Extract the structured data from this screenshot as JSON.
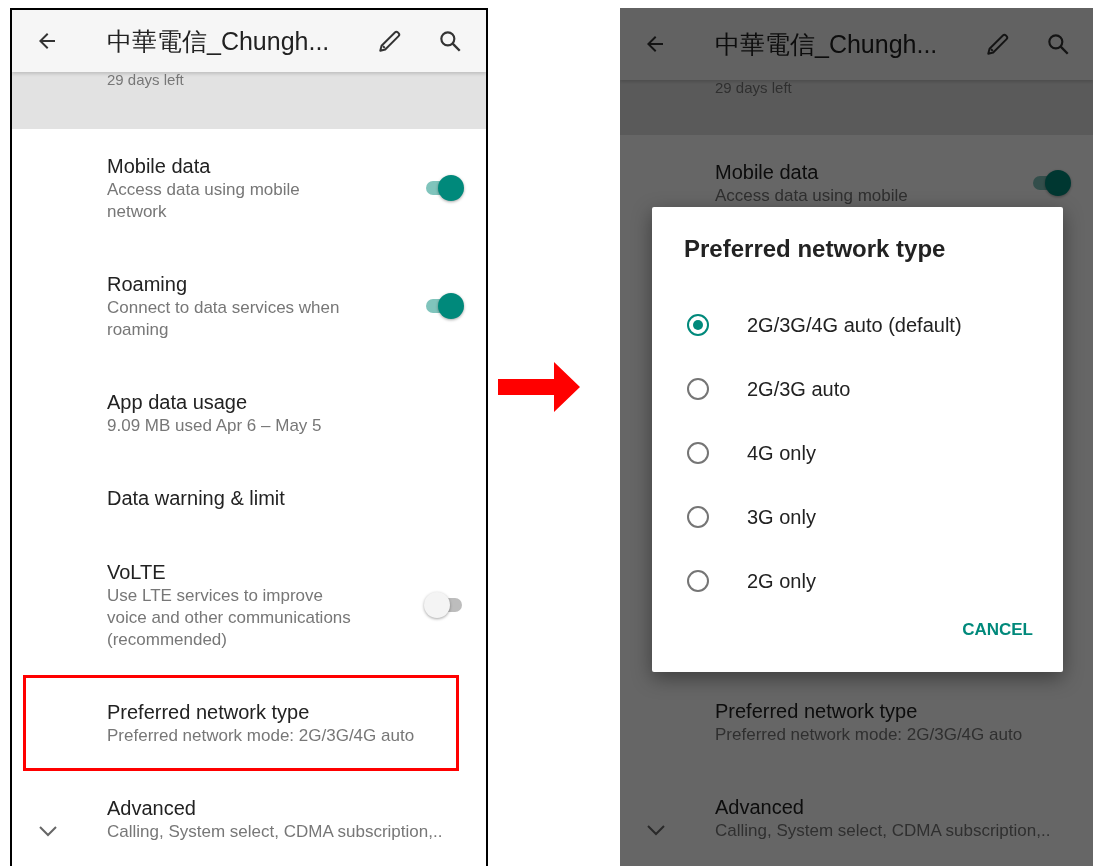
{
  "screens": [
    {
      "title": "中華電信_Chungh...",
      "banner": "29 days left",
      "dimmed": false,
      "items": [
        {
          "kind": "toggle",
          "title": "Mobile data",
          "subtitle": "Access data using mobile network",
          "on": true,
          "highlighted": false
        },
        {
          "kind": "toggle",
          "title": "Roaming",
          "subtitle": "Connect to data services when roaming",
          "on": true,
          "highlighted": false
        },
        {
          "kind": "plain",
          "title": "App data usage",
          "subtitle": "9.09 MB used Apr 6 – May 5",
          "highlighted": false
        },
        {
          "kind": "plain",
          "title": "Data warning & limit",
          "highlighted": false
        },
        {
          "kind": "toggle",
          "title": "VoLTE",
          "subtitle": "Use LTE services to improve voice and other communications (recommended)",
          "on": false,
          "highlighted": false
        },
        {
          "kind": "plain",
          "title": "Preferred network type",
          "subtitle": "Preferred network mode: 2G/3G/4G auto",
          "highlighted": true
        },
        {
          "kind": "expand",
          "title": "Advanced",
          "subtitle": "Calling, System select, CDMA subscription,..",
          "highlighted": false
        }
      ]
    },
    {
      "title": "中華電信_Chungh...",
      "banner": "29 days left",
      "dimmed": true,
      "items": [
        {
          "kind": "toggle",
          "title": "Mobile data",
          "subtitle": "Access data using mobile",
          "on": true,
          "highlighted": false
        },
        {
          "kind": "plain",
          "title": "Preferred network type",
          "subtitle": "Preferred network mode: 2G/3G/4G auto",
          "highlighted": false
        },
        {
          "kind": "expand",
          "title": "Advanced",
          "subtitle": "Calling, System select, CDMA subscription,..",
          "highlighted": false
        }
      ],
      "dialog": {
        "title": "Preferred network type",
        "options": [
          {
            "label": "2G/3G/4G auto (default)",
            "selected": true
          },
          {
            "label": "2G/3G auto",
            "selected": false
          },
          {
            "label": "4G only",
            "selected": false
          },
          {
            "label": "3G only",
            "selected": false
          },
          {
            "label": "2G only",
            "selected": false
          }
        ],
        "button": "CANCEL"
      }
    }
  ]
}
